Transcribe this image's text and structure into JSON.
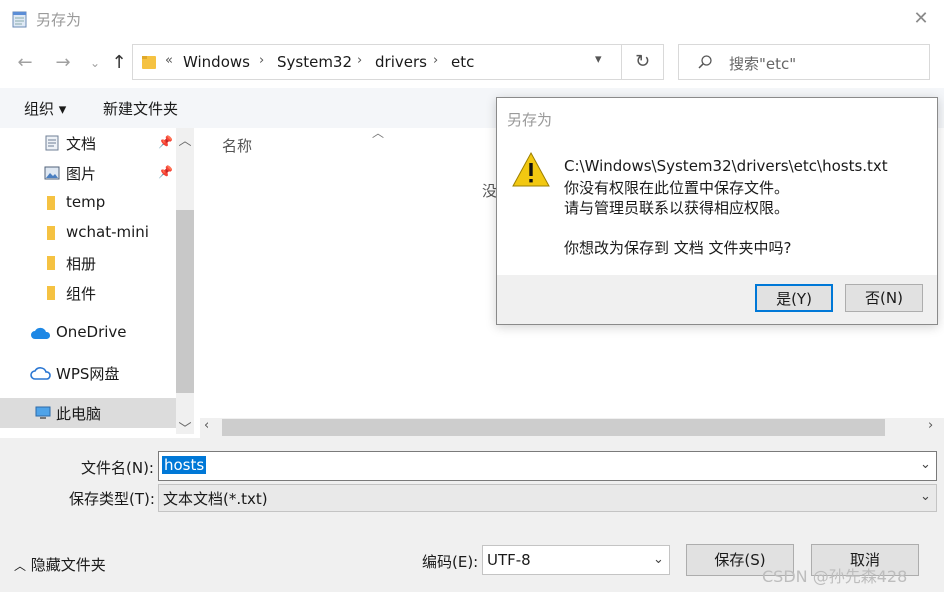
{
  "window": {
    "title": "另存为"
  },
  "nav": {
    "path_prefix": "«",
    "breadcrumbs": [
      "Windows",
      "System32",
      "drivers",
      "etc"
    ],
    "search_placeholder": "搜索\"etc\""
  },
  "toolbar": {
    "organize": "组织 ▾",
    "new_folder": "新建文件夹"
  },
  "sidebar": {
    "items": [
      {
        "label": "文档",
        "icon": "document-icon",
        "pinned": true
      },
      {
        "label": "图片",
        "icon": "picture-icon",
        "pinned": true
      },
      {
        "label": "temp",
        "icon": "folder-icon"
      },
      {
        "label": "wchat-mini",
        "icon": "folder-icon"
      },
      {
        "label": "相册",
        "icon": "folder-icon"
      },
      {
        "label": "组件",
        "icon": "folder-icon"
      },
      {
        "label": "OneDrive",
        "icon": "cloud-icon"
      },
      {
        "label": "WPS网盘",
        "icon": "cloud-outline-icon"
      },
      {
        "label": "此电脑",
        "icon": "computer-icon"
      }
    ]
  },
  "file_list": {
    "column_name": "名称",
    "empty_text": "没"
  },
  "form": {
    "filename_label": "文件名(N):",
    "filename_value": "hosts",
    "type_label": "保存类型(T):",
    "type_value": "文本文档(*.txt)",
    "hide_folders": "隐藏文件夹",
    "encoding_label": "编码(E):",
    "encoding_value": "UTF-8",
    "save": "保存(S)",
    "cancel": "取消"
  },
  "dialog": {
    "title": "另存为",
    "lines": [
      "C:\\Windows\\System32\\drivers\\etc\\hosts.txt",
      "你没有权限在此位置中保存文件。",
      "请与管理员联系以获得相应权限。",
      "你想改为保存到 文档 文件夹中吗?"
    ],
    "yes": "是(Y)",
    "no": "否(N)"
  },
  "watermark": "CSDN @孙先森428",
  "colors": {
    "accent": "#0078d7",
    "warning": "#f2c811",
    "folder": "#f5c242"
  }
}
